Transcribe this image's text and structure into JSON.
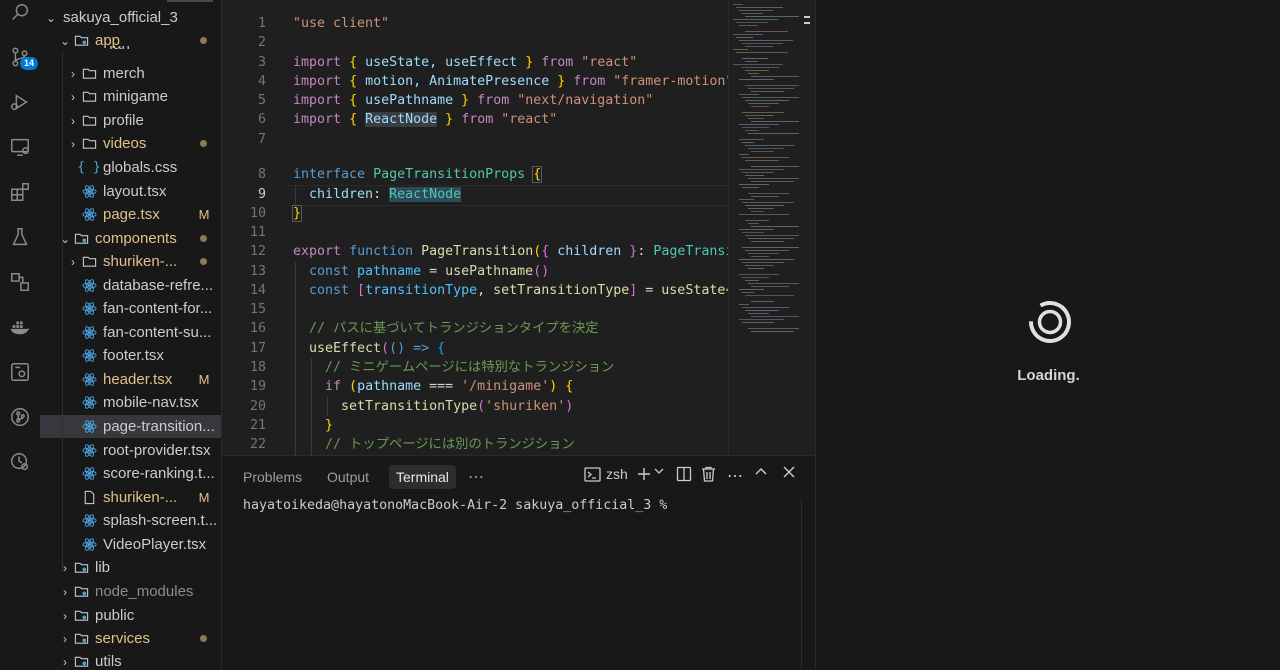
{
  "activity_bar": {
    "scm_badge": "14"
  },
  "explorer": {
    "root": "sakuya_official_3",
    "partial_folder": "fan",
    "rows": [
      {
        "label": "app"
      },
      {
        "label": "merch"
      },
      {
        "label": "minigame"
      },
      {
        "label": "profile"
      },
      {
        "label": "videos"
      },
      {
        "label": "globals.css"
      },
      {
        "label": "layout.tsx"
      },
      {
        "label": "page.tsx",
        "status": "M"
      },
      {
        "label": "components"
      },
      {
        "label": "shuriken-..."
      },
      {
        "label": "database-refre..."
      },
      {
        "label": "fan-content-for..."
      },
      {
        "label": "fan-content-su..."
      },
      {
        "label": "footer.tsx"
      },
      {
        "label": "header.tsx",
        "status": "M"
      },
      {
        "label": "mobile-nav.tsx"
      },
      {
        "label": "page-transition..."
      },
      {
        "label": "root-provider.tsx"
      },
      {
        "label": "score-ranking.t..."
      },
      {
        "label": "shuriken-...",
        "status": "M"
      },
      {
        "label": "splash-screen.t..."
      },
      {
        "label": "VideoPlayer.tsx"
      },
      {
        "label": "lib"
      },
      {
        "label": "node_modules"
      },
      {
        "label": "public"
      },
      {
        "label": "services"
      },
      {
        "label": "utils"
      }
    ]
  },
  "editor": {
    "lines": [
      {
        "n": "1",
        "tokens": [
          [
            "\"use client\"",
            "#ce9178"
          ]
        ]
      },
      {
        "n": "2",
        "tokens": []
      },
      {
        "n": "3",
        "tokens": [
          [
            "import",
            "#c586c0"
          ],
          [
            " ",
            "#d4d4d4"
          ],
          [
            "{",
            "#ffd700"
          ],
          [
            " useState, useEffect ",
            "#9cdcfe"
          ],
          [
            "}",
            "#ffd700"
          ],
          [
            " from ",
            "#c586c0"
          ],
          [
            "\"react\"",
            "#ce9178"
          ]
        ]
      },
      {
        "n": "4",
        "tokens": [
          [
            "import",
            "#c586c0"
          ],
          [
            " ",
            "#d4d4d4"
          ],
          [
            "{",
            "#ffd700"
          ],
          [
            " motion, AnimatePresence ",
            "#9cdcfe"
          ],
          [
            "}",
            "#ffd700"
          ],
          [
            " from ",
            "#c586c0"
          ],
          [
            "\"framer-motion\"",
            "#ce9178"
          ]
        ]
      },
      {
        "n": "5",
        "tokens": [
          [
            "import",
            "#c586c0"
          ],
          [
            " ",
            "#d4d4d4"
          ],
          [
            "{",
            "#ffd700"
          ],
          [
            " usePathname ",
            "#9cdcfe"
          ],
          [
            "}",
            "#ffd700"
          ],
          [
            " from ",
            "#c586c0"
          ],
          [
            "\"next/navigation\"",
            "#ce9178"
          ]
        ]
      },
      {
        "n": "6",
        "tokens": [
          [
            "import",
            "#c586c0"
          ],
          [
            " ",
            "#d4d4d4"
          ],
          [
            "{",
            "#ffd700"
          ],
          [
            " ",
            "#d4d4d4"
          ],
          [
            "ReactNode",
            "#9cdcfe"
          ],
          [
            " ",
            "#d4d4d4"
          ],
          [
            "}",
            "#ffd700"
          ],
          [
            " from ",
            "#c586c0"
          ],
          [
            "\"react\"",
            "#ce9178"
          ]
        ]
      },
      {
        "n": "7",
        "tokens": []
      },
      {
        "n": "8",
        "tokens": [
          [
            "interface",
            "#569cd6"
          ],
          [
            " ",
            "#d4d4d4"
          ],
          [
            "PageTransitionProps",
            "#4ec9b0"
          ],
          [
            " ",
            "#d4d4d4"
          ],
          [
            "{",
            "#ffd700"
          ]
        ]
      },
      {
        "n": "9",
        "tokens": [
          [
            "  children",
            "#9cdcfe"
          ],
          [
            ": ",
            "#d4d4d4"
          ],
          [
            "ReactNode",
            "#4ec9b0"
          ]
        ]
      },
      {
        "n": "10",
        "tokens": [
          [
            "}",
            "#ffd700"
          ]
        ]
      },
      {
        "n": "11",
        "tokens": []
      },
      {
        "n": "12",
        "tokens": [
          [
            "export",
            "#c586c0"
          ],
          [
            " ",
            "#d4d4d4"
          ],
          [
            "function",
            "#569cd6"
          ],
          [
            " ",
            "#d4d4d4"
          ],
          [
            "PageTransition",
            "#dcdcaa"
          ],
          [
            "(",
            "#ffd700"
          ],
          [
            "{",
            "#da70d6"
          ],
          [
            " children ",
            "#9cdcfe"
          ],
          [
            "}",
            "#da70d6"
          ],
          [
            ": ",
            "#d4d4d4"
          ],
          [
            "PageTransiti",
            "#4ec9b0"
          ]
        ]
      },
      {
        "n": "13",
        "tokens": [
          [
            "  const",
            "#569cd6"
          ],
          [
            " pathname ",
            "#4fc1ff"
          ],
          [
            "= ",
            "#d4d4d4"
          ],
          [
            "usePathname",
            "#dcdcaa"
          ],
          [
            "()",
            "#da70d6"
          ]
        ]
      },
      {
        "n": "14",
        "tokens": [
          [
            "  const",
            "#569cd6"
          ],
          [
            " [",
            "#da70d6"
          ],
          [
            "transitionType",
            "#4fc1ff"
          ],
          [
            ", ",
            "#d4d4d4"
          ],
          [
            "setTransitionType",
            "#dcdcaa"
          ],
          [
            "]",
            "#da70d6"
          ],
          [
            " = ",
            "#d4d4d4"
          ],
          [
            "useState",
            "#dcdcaa"
          ],
          [
            "<'s",
            "#ce9178"
          ]
        ]
      },
      {
        "n": "15",
        "tokens": []
      },
      {
        "n": "16",
        "tokens": [
          [
            "  // パスに基づいてトランジションタイプを決定",
            "#6a9955"
          ]
        ]
      },
      {
        "n": "17",
        "tokens": [
          [
            "  useEffect",
            "#dcdcaa"
          ],
          [
            "(",
            "#da70d6"
          ],
          [
            "() => ",
            "#569cd6"
          ],
          [
            "{",
            "#179fff"
          ]
        ]
      },
      {
        "n": "18",
        "tokens": [
          [
            "    // ミニゲームページには特別なトランジション",
            "#6a9955"
          ]
        ]
      },
      {
        "n": "19",
        "tokens": [
          [
            "    if",
            "#c586c0"
          ],
          [
            " (",
            "#ffd700"
          ],
          [
            "pathname",
            "#9cdcfe"
          ],
          [
            " === ",
            "#d4d4d4"
          ],
          [
            "'/minigame'",
            "#ce9178"
          ],
          [
            ") ",
            "#ffd700"
          ],
          [
            "{",
            "#ffd700"
          ]
        ]
      },
      {
        "n": "20",
        "tokens": [
          [
            "      setTransitionType",
            "#dcdcaa"
          ],
          [
            "(",
            "#da70d6"
          ],
          [
            "'shuriken'",
            "#ce9178"
          ],
          [
            ")",
            "#da70d6"
          ]
        ]
      },
      {
        "n": "21",
        "tokens": [
          [
            "    }",
            "#ffd700"
          ]
        ]
      },
      {
        "n": "22",
        "tokens": [
          [
            "    // トップページには別のトランジション",
            "#6a9955"
          ]
        ]
      }
    ]
  },
  "panel": {
    "tabs": [
      "Problems",
      "Output",
      "Terminal"
    ],
    "more": "⋯",
    "shell": "zsh",
    "prompt": "hayatoikeda@hayatonoMacBook-Air-2 sakuya_official_3 %"
  },
  "preview": {
    "loading": "Loading."
  }
}
